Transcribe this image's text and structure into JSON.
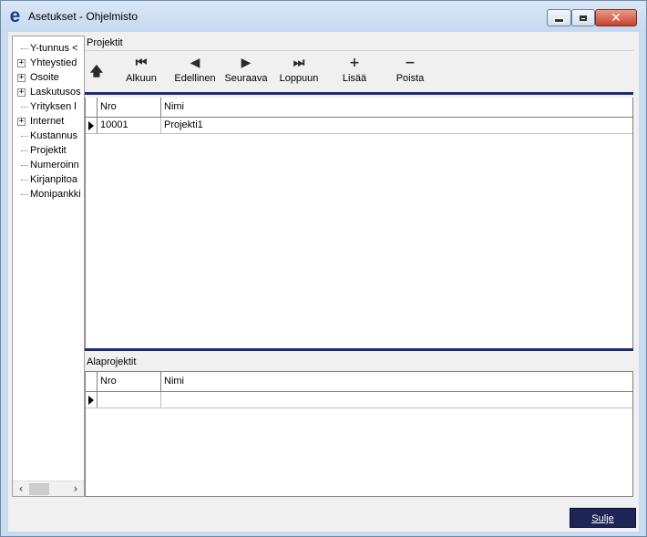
{
  "window": {
    "title": "Asetukset - Ohjelmisto",
    "app_icon_glyph": "e",
    "controls": {
      "minimize_icon": "minimize-icon",
      "maximize_icon": "maximize-icon",
      "close_icon": "close-icon",
      "close_glyph": "✕"
    }
  },
  "tree": {
    "items": [
      {
        "label": "Y-tunnus <",
        "expandable": false
      },
      {
        "label": "Yhteystied",
        "expandable": true
      },
      {
        "label": "Osoite",
        "expandable": true
      },
      {
        "label": "Laskutusos",
        "expandable": true
      },
      {
        "label": "Yrityksen l",
        "expandable": false
      },
      {
        "label": "Internet",
        "expandable": true
      },
      {
        "label": "Kustannus",
        "expandable": false
      },
      {
        "label": "Projektit",
        "expandable": false
      },
      {
        "label": "Numeroinn",
        "expandable": false
      },
      {
        "label": "Kirjanpitoa",
        "expandable": false
      },
      {
        "label": "Monipankki",
        "expandable": false
      }
    ],
    "expand_glyph": "+",
    "scroll_left_glyph": "‹",
    "scroll_right_glyph": "›"
  },
  "projects": {
    "section_title": "Projektit",
    "toolbar": {
      "up_glyph": "🡅",
      "buttons": [
        {
          "id": "first",
          "label": "Alkuun",
          "glyph": "⏮",
          "icon": "first-record-icon"
        },
        {
          "id": "prev",
          "label": "Edellinen",
          "glyph": "◀",
          "icon": "previous-record-icon"
        },
        {
          "id": "next",
          "label": "Seuraava",
          "glyph": "▶",
          "icon": "next-record-icon"
        },
        {
          "id": "last",
          "label": "Loppuun",
          "glyph": "⏭",
          "icon": "last-record-icon"
        },
        {
          "id": "add",
          "label": "Lisää",
          "glyph": "+",
          "icon": "add-icon"
        },
        {
          "id": "delete",
          "label": "Poista",
          "glyph": "−",
          "icon": "delete-icon"
        }
      ]
    },
    "columns": [
      "Nro",
      "Nimi"
    ],
    "rows": [
      {
        "nro": "10001",
        "nimi": "Projekti1"
      }
    ]
  },
  "subprojects": {
    "section_title": "Alaprojektit",
    "columns": [
      "Nro",
      "Nimi"
    ],
    "rows": [
      {
        "nro": "",
        "nimi": ""
      }
    ]
  },
  "footer": {
    "close_label": "Sulje"
  },
  "colors": {
    "accent": "#1e2a6e",
    "close_button": "#1f2456"
  }
}
